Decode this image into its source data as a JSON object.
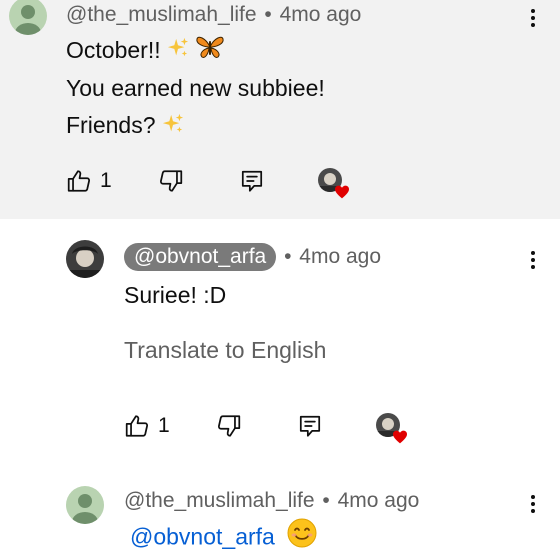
{
  "comments": [
    {
      "author": "@the_muslimah_life",
      "separator": "•",
      "time": "4mo ago",
      "lines": [
        "October!!",
        "You earned new subbiee!",
        "Friends?"
      ],
      "like_count": "1"
    },
    {
      "author": "@obvnot_arfa",
      "separator": "•",
      "time": "4mo ago",
      "text": "Suriee! :D",
      "translate": "Translate to English",
      "like_count": "1"
    },
    {
      "author": "@the_muslimah_life",
      "separator": "•",
      "time": "4mo ago",
      "mention": "@obvnot_arfa"
    }
  ],
  "colors": {
    "highlight_bg": "#f2f2f2",
    "mention": "#065fd4",
    "heart": "#e00000",
    "pill": "#7a7a7a"
  },
  "icons": {
    "like": "thumbs-up-icon",
    "dislike": "thumbs-down-icon",
    "reply": "reply-icon",
    "more": "more-vert-icon",
    "sparkles": "sparkles-icon",
    "butterfly": "butterfly-icon",
    "smile": "smiling-face-icon"
  }
}
